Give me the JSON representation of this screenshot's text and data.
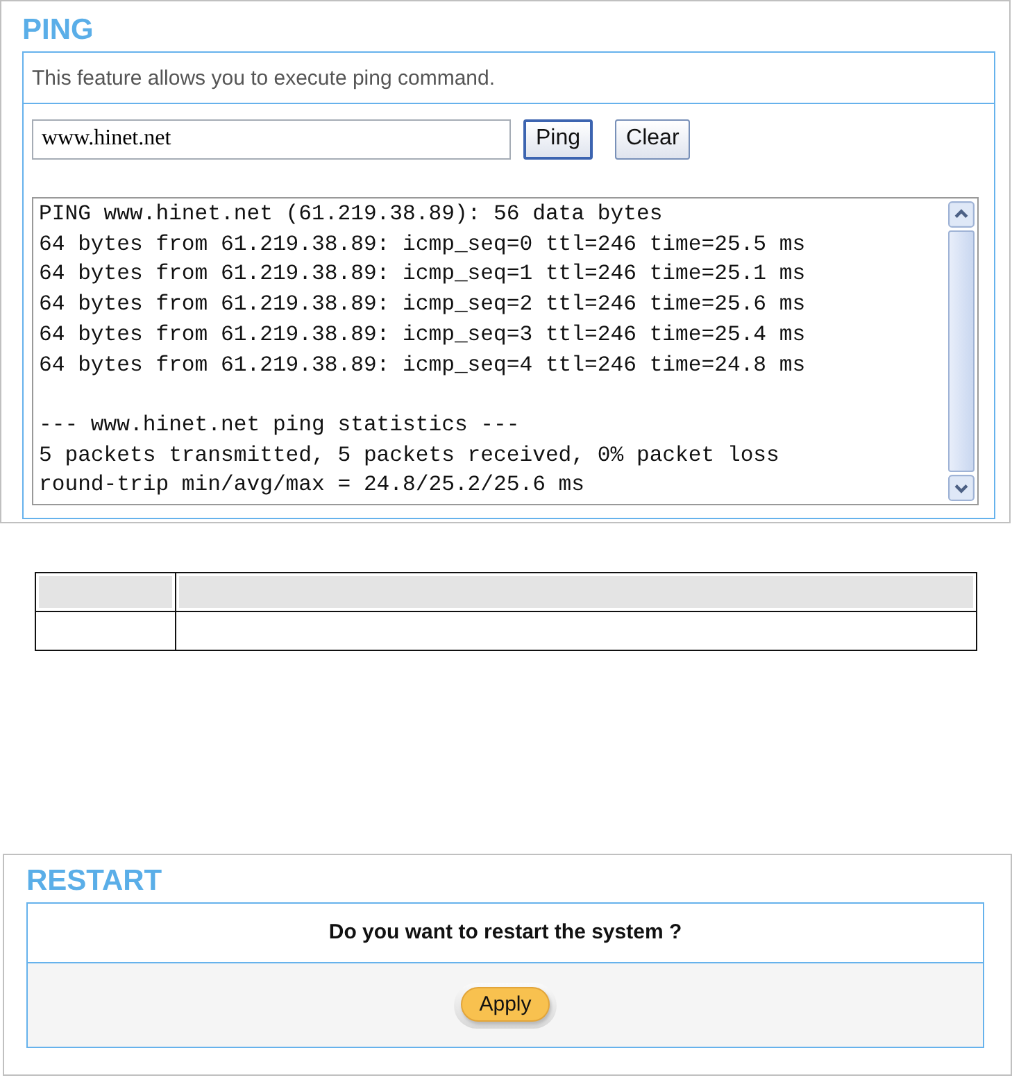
{
  "ping": {
    "title": "PING",
    "description": "This feature allows you to execute ping command.",
    "host_field": {
      "value": "www.hinet.net"
    },
    "buttons": [
      "Ping",
      "Clear"
    ],
    "output_blocks": [
      [
        "PING www.hinet.net (61.219.38.89): 56 data bytes",
        "64 bytes from 61.219.38.89: icmp_seq=0 ttl=246 time=25.5 ms",
        "64 bytes from 61.219.38.89: icmp_seq=1 ttl=246 time=25.1 ms",
        "64 bytes from 61.219.38.89: icmp_seq=2 ttl=246 time=25.6 ms",
        "64 bytes from 61.219.38.89: icmp_seq=3 ttl=246 time=25.4 ms",
        "64 bytes from 61.219.38.89: icmp_seq=4 ttl=246 time=24.8 ms"
      ],
      [
        "--- www.hinet.net ping statistics ---",
        "5 packets transmitted, 5 packets received, 0% packet loss",
        "round-trip min/avg/max = 24.8/25.2/25.6 ms"
      ]
    ]
  },
  "restart": {
    "title": "RESTART",
    "question": "Do you want to restart the system ?",
    "button": "Apply"
  }
}
